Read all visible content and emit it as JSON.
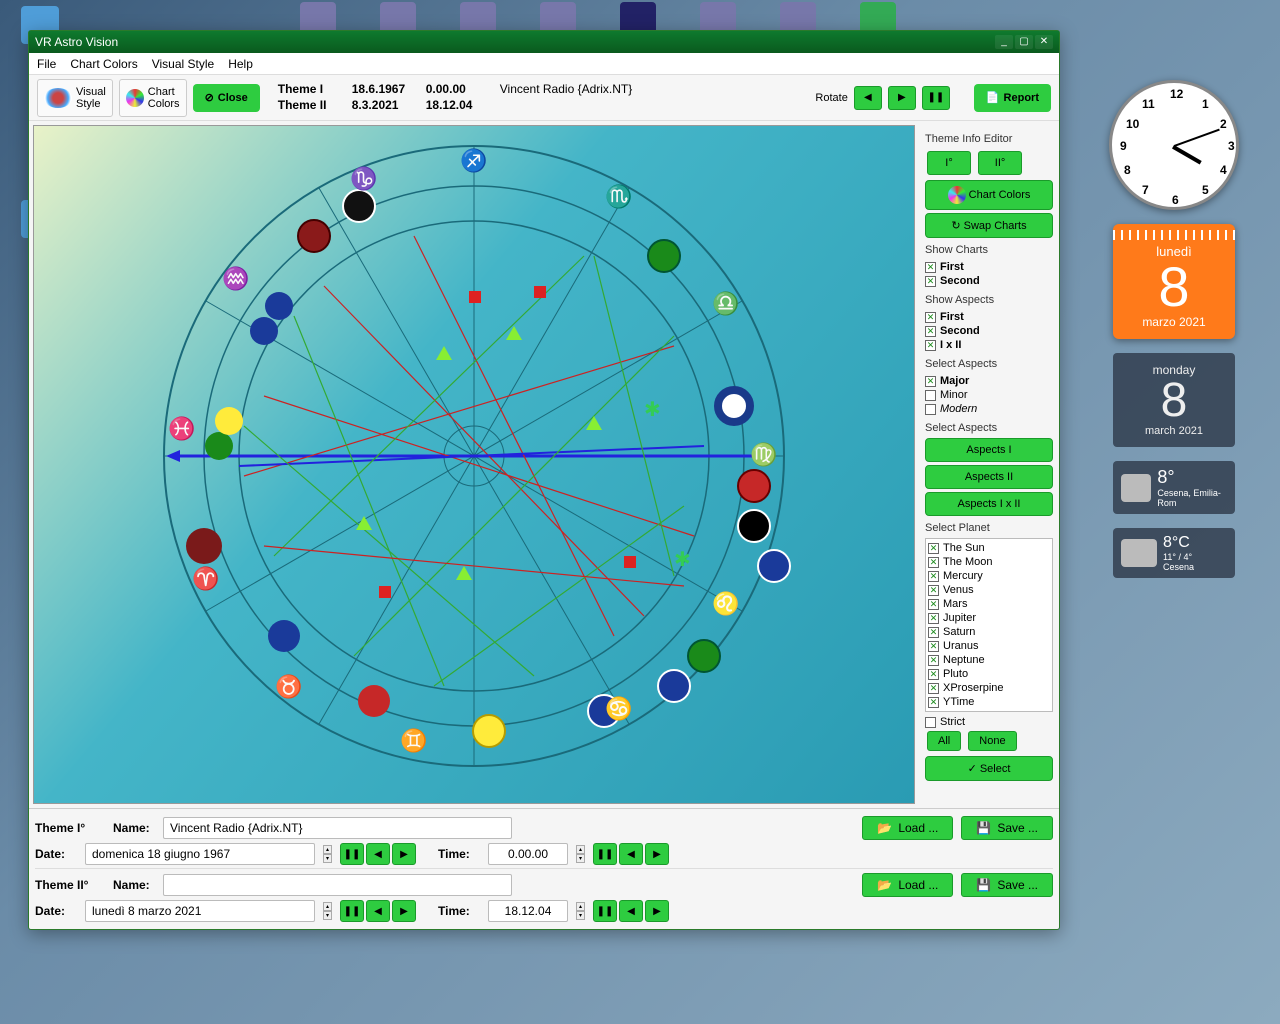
{
  "window": {
    "title": "VR Astro Vision"
  },
  "menu": {
    "file": "File",
    "chartColors": "Chart Colors",
    "visualStyle": "Visual Style",
    "help": "Help"
  },
  "toolbar": {
    "visualStyle": "Visual\nStyle",
    "chartColors": "Chart\nColors",
    "close": "Close",
    "theme1_lbl": "Theme I",
    "theme1_date": "18.6.1967",
    "theme1_time": "0.00.00",
    "theme1_name": "Vincent Radio {Adrix.NT}",
    "theme2_lbl": "Theme II",
    "theme2_date": "8.3.2021",
    "theme2_time": "18.12.04",
    "rotate": "Rotate",
    "report": "Report"
  },
  "side": {
    "editorHdr": "Theme Info Editor",
    "t1": "I°",
    "t2": "II°",
    "chartColors": "Chart Colors",
    "swap": "Swap Charts",
    "showCharts": "Show Charts",
    "first": "First",
    "second": "Second",
    "showAspects": "Show Aspects",
    "IxII": "I x II",
    "selectAspectsHdr": "Select Aspects",
    "major": "Major",
    "minor": "Minor",
    "modern": "Modern",
    "selectAspects2": "Select Aspects",
    "aspects1": "Aspects I",
    "aspects2": "Aspects II",
    "aspects12": "Aspects I x II",
    "selectPlanet": "Select Planet",
    "planets": [
      "The Sun",
      "The Moon",
      "Mercury",
      "Venus",
      "Mars",
      "Jupiter",
      "Saturn",
      "Uranus",
      "Neptune",
      "Pluto",
      "XProserpine",
      "YTime"
    ],
    "strict": "Strict",
    "all": "All",
    "none": "None",
    "select": "Select"
  },
  "bottom": {
    "theme1Hdr": "Theme I°",
    "nameLbl": "Name:",
    "name1": "Vincent Radio {Adrix.NT}",
    "dateLbl": "Date:",
    "date1": "domenica 18 giugno 1967",
    "timeLbl": "Time:",
    "time1": "0.00.00",
    "theme2Hdr": "Theme II°",
    "name2": "",
    "date2": "lunedì 8 marzo 2021",
    "time2": "18.12.04",
    "load": "Load ...",
    "save": "Save ..."
  },
  "widgets": {
    "cal1_day": "lunedì",
    "cal1_num": "8",
    "cal1_my": "marzo 2021",
    "cal2_day": "monday",
    "cal2_num": "8",
    "cal2_my": "march 2021",
    "w1_temp": "8°",
    "w1_loc": "Cesena, Emilia-Rom",
    "w2_temp": "8°C",
    "w2_range": "11° / 4°",
    "w2_loc": "Cesena"
  },
  "chart_data": {
    "type": "astrological-chart",
    "title": "Natal + Transit synastry wheel",
    "zodiac_signs": [
      "Aries",
      "Taurus",
      "Gemini",
      "Cancer",
      "Leo",
      "Virgo",
      "Libra",
      "Scorpio",
      "Sagittarius",
      "Capricorn",
      "Aquarius",
      "Pisces"
    ],
    "theme_I": {
      "date": "1967-06-18",
      "time": "00:00:00",
      "planet_positions_deg_approx": {
        "Sun": 86,
        "Moon": 185,
        "Mercury": 80,
        "Venus": 125,
        "Mars": 200,
        "Jupiter": 128,
        "Saturn": 10,
        "Uranus": 170,
        "Neptune": 232,
        "Pluto": 168
      }
    },
    "theme_II": {
      "date": "2021-03-08",
      "time": "18:12:04",
      "planet_positions_deg_approx": {
        "Sun": 348,
        "Moon": 300,
        "Mercury": 328,
        "Venus": 346,
        "Mars": 70,
        "Jupiter": 320,
        "Saturn": 309,
        "Uranus": 37,
        "Neptune": 350,
        "Pluto": 296
      }
    },
    "aspects_shown": [
      "Major"
    ],
    "aspect_colors": {
      "square": "#cc2222",
      "trine": "#33aa33",
      "sextile": "#33aa33",
      "opposition": "#2222cc",
      "conjunction": "#999900"
    }
  }
}
